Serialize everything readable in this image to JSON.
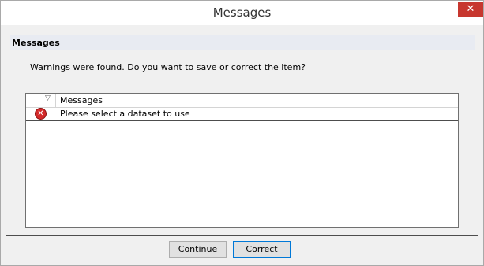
{
  "window": {
    "title": "Messages",
    "close_label": "✕"
  },
  "panel": {
    "header": "Messages",
    "message": "Warnings were found.  Do you want to save or correct the item?"
  },
  "grid": {
    "sort_glyph": "▽",
    "column_header": "Messages",
    "rows": [
      {
        "icon": "error-icon",
        "text": "Please select a dataset to use"
      }
    ]
  },
  "buttons": {
    "continue": "Continue",
    "correct": "Correct"
  }
}
